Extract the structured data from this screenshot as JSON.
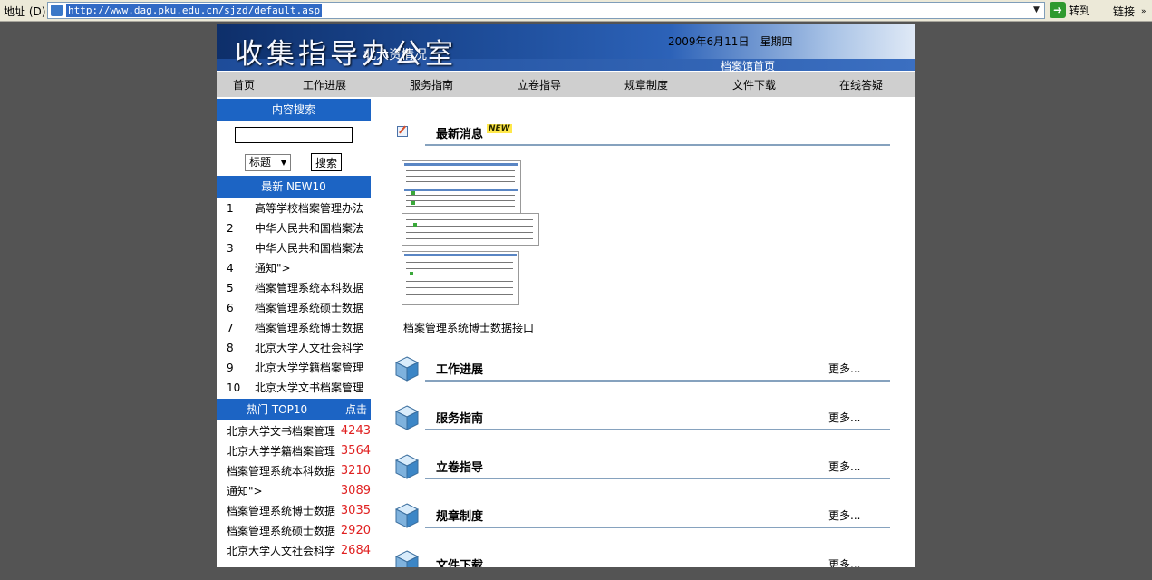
{
  "browser": {
    "address_label": "地址 (D)",
    "url": "http://www.dag.pku.edu.cn/sjzd/default.asp",
    "go_label": "转到",
    "links_label": "链接"
  },
  "header": {
    "site_title": "收集指导办公室",
    "stats_text": "北大资情况",
    "date_text": "2009年6月11日　星期四",
    "archive_home_link": "档案馆首页"
  },
  "nav": {
    "items": [
      "首页",
      "工作进展",
      "服务指南",
      "立卷指导",
      "规章制度",
      "文件下载",
      "在线答疑"
    ]
  },
  "sidebar": {
    "search_header": "内容搜索",
    "search_value": "",
    "field_select": "标题",
    "search_button": "搜索",
    "new_header": "最新 NEW10",
    "new_items": [
      {
        "num": "1",
        "title": "高等学校档案管理办法"
      },
      {
        "num": "2",
        "title": "中华人民共和国档案法"
      },
      {
        "num": "3",
        "title": "中华人民共和国档案法"
      },
      {
        "num": "4",
        "title": "通知\">"
      },
      {
        "num": "5",
        "title": "档案管理系统本科数据"
      },
      {
        "num": "6",
        "title": "档案管理系统硕士数据"
      },
      {
        "num": "7",
        "title": "档案管理系统博士数据"
      },
      {
        "num": "8",
        "title": "北京大学人文社会科学"
      },
      {
        "num": "9",
        "title": "北京大学学籍档案管理"
      },
      {
        "num": "10",
        "title": "北京大学文书档案管理"
      }
    ],
    "hot_header": "热门 TOP10",
    "hot_click_label": "点击",
    "hot_items": [
      {
        "title": "北京大学文书档案管理",
        "count": "4243"
      },
      {
        "title": "北京大学学籍档案管理",
        "count": "3564"
      },
      {
        "title": "档案管理系统本科数据",
        "count": "3210"
      },
      {
        "title": "通知\">",
        "count": "3089"
      },
      {
        "title": "档案管理系统博士数据",
        "count": "3035"
      },
      {
        "title": "档案管理系统硕士数据",
        "count": "2920"
      },
      {
        "title": "北京大学人文社会科学",
        "count": "2684"
      }
    ]
  },
  "main": {
    "latest_news_title": "最新消息",
    "new_badge": "NEW",
    "news_caption": "档案管理系统博士数据接口",
    "sections": [
      {
        "title": "工作进展",
        "more": "更多..."
      },
      {
        "title": "服务指南",
        "more": "更多..."
      },
      {
        "title": "立卷指导",
        "more": "更多..."
      },
      {
        "title": "规章制度",
        "more": "更多..."
      },
      {
        "title": "文件下载",
        "more": "更多..."
      }
    ]
  }
}
